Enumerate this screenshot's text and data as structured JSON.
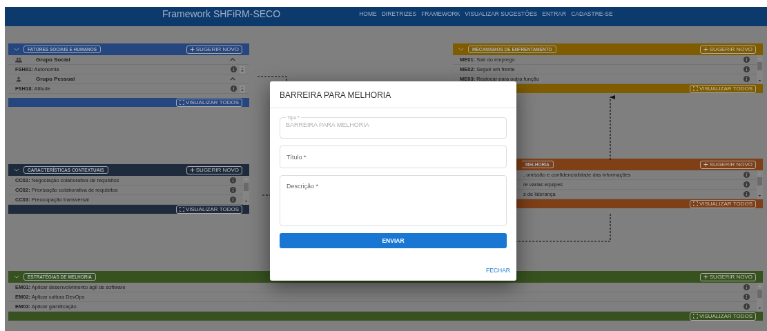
{
  "header": {
    "title": "Framework SHFiRM-SECO",
    "nav": [
      "HOME",
      "DIRETRIZES",
      "FRAMEWORK",
      "VISUALIZAR SUGESTÕES",
      "ENTRAR",
      "CADASTRE-SE"
    ]
  },
  "left_panels": [
    {
      "kind": "grouped",
      "color": "#25467f",
      "title": "FATORES SOCIAIS E HUMANOS",
      "action": "SUGERIR NOVO",
      "footer": "VISUALIZAR TODOS",
      "groups": [
        {
          "kind": "people",
          "name": "Grupo Social",
          "expanded": true,
          "items": [
            "**FSH01:** Autonomia"
          ]
        },
        {
          "kind": "person",
          "name": "Grupo Pessoal",
          "expanded": true,
          "items": [
            "**FSH18:** Atitude"
          ]
        }
      ]
    },
    {
      "kind": "list",
      "color": "#1e2b3d",
      "title": "CARACTERÍSTICAS CONTEXTUAIS",
      "action": "SUGERIR NOVO",
      "footer": "VISUALIZAR TODOS",
      "items": [
        "**CC01:** Negociação colaborativa de requisitos",
        "**CC02:** Priorização colaborativa de requisitos",
        "**CC03:** Preocupação transversal"
      ]
    }
  ],
  "right_panels": [
    {
      "kind": "list",
      "color": "#7f5c00",
      "title": "MECANISMOS DE ENFRENTAMENTO",
      "action": "SUGERIR NOVO",
      "footer": "VISUALIZAR TODOS",
      "items": [
        "**ME01:** Sair do emprego",
        "**ME02:** Seguir em frente",
        "**ME03:** Realocar para outra função"
      ]
    },
    {
      "kind": "list",
      "color": "#7f3f17",
      "title": "MELHORIA",
      "action": "SUGERIR NOVO",
      "footer": "VISUALIZAR TODOS",
      "items": [
        ", omissão e confidencialidade das informações",
        "re várias equipes",
        "s de liderança"
      ]
    }
  ],
  "bottom_panels": [
    {
      "kind": "list",
      "color": "#37521f",
      "title": "ESTRATÉGIAS DE MELHORIA",
      "action": "SUGERIR NOVO",
      "footer": "VISUALIZAR TODOS",
      "items": [
        "**EM01:** Aplicar desenvolvimento ágil de software",
        "**EM02:** Aplicar cultura DevOps",
        "**EM03:** Aplicar gamificação"
      ]
    }
  ],
  "dialog": {
    "title": "BARREIRA PARA MELHORIA",
    "fields": [
      {
        "kind": "locked",
        "label": "Tipo *",
        "value": "BARREIRA PARA MELHORIA"
      },
      {
        "kind": "input",
        "placeholder": "Título *"
      },
      {
        "kind": "textarea",
        "placeholder": "Descrição *"
      }
    ],
    "submit": "ENVIAR",
    "close": "FECHAR"
  }
}
